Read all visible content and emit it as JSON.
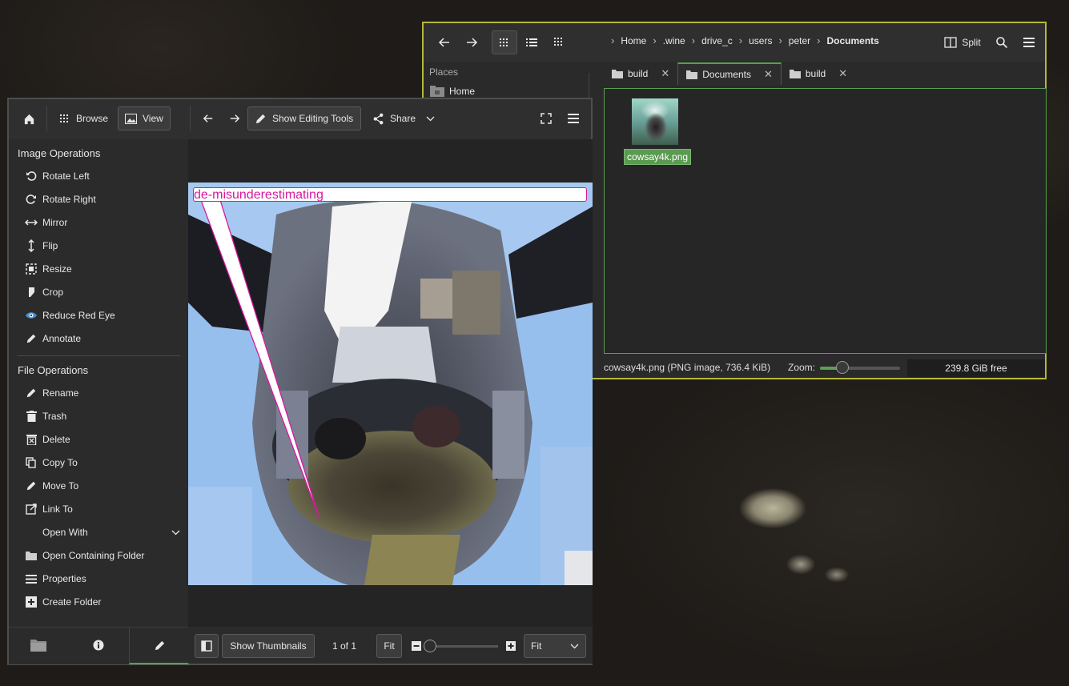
{
  "file_manager": {
    "breadcrumbs": [
      "Home",
      ".wine",
      "drive_c",
      "users",
      "peter",
      "Documents"
    ],
    "split_label": "Split",
    "places": {
      "header": "Places",
      "home": "Home"
    },
    "tabs": [
      {
        "label": "build",
        "active": false
      },
      {
        "label": "Documents",
        "active": true
      },
      {
        "label": "build",
        "active": false
      }
    ],
    "file": {
      "name": "cowsay4k.png"
    },
    "status": {
      "info": "cowsay4k.png (PNG image, 736.4 KiB)",
      "zoom_label": "Zoom:",
      "free_space": "239.8 GiB free"
    },
    "accent_color": "#b5b936"
  },
  "image_viewer": {
    "toolbar": {
      "browse": "Browse",
      "view": "View",
      "editing_tools": "Show Editing Tools",
      "share": "Share"
    },
    "image_operations": {
      "title": "Image Operations",
      "items": [
        "Rotate Left",
        "Rotate Right",
        "Mirror",
        "Flip",
        "Resize",
        "Crop",
        "Reduce Red Eye",
        "Annotate"
      ]
    },
    "file_operations": {
      "title": "File Operations",
      "items": [
        "Rename",
        "Trash",
        "Delete",
        "Copy To",
        "Move To",
        "Link To",
        "Open With",
        "Open Containing Folder",
        "Properties",
        "Create Folder"
      ]
    },
    "annotation_text": "de-misunderestimating",
    "bottom": {
      "show_thumbnails": "Show Thumbnails",
      "page_counter": "1 of 1",
      "fit_button": "Fit",
      "zoom_select": "Fit"
    },
    "accent_color": "#58a050",
    "annotation_color": "#d7189f"
  }
}
